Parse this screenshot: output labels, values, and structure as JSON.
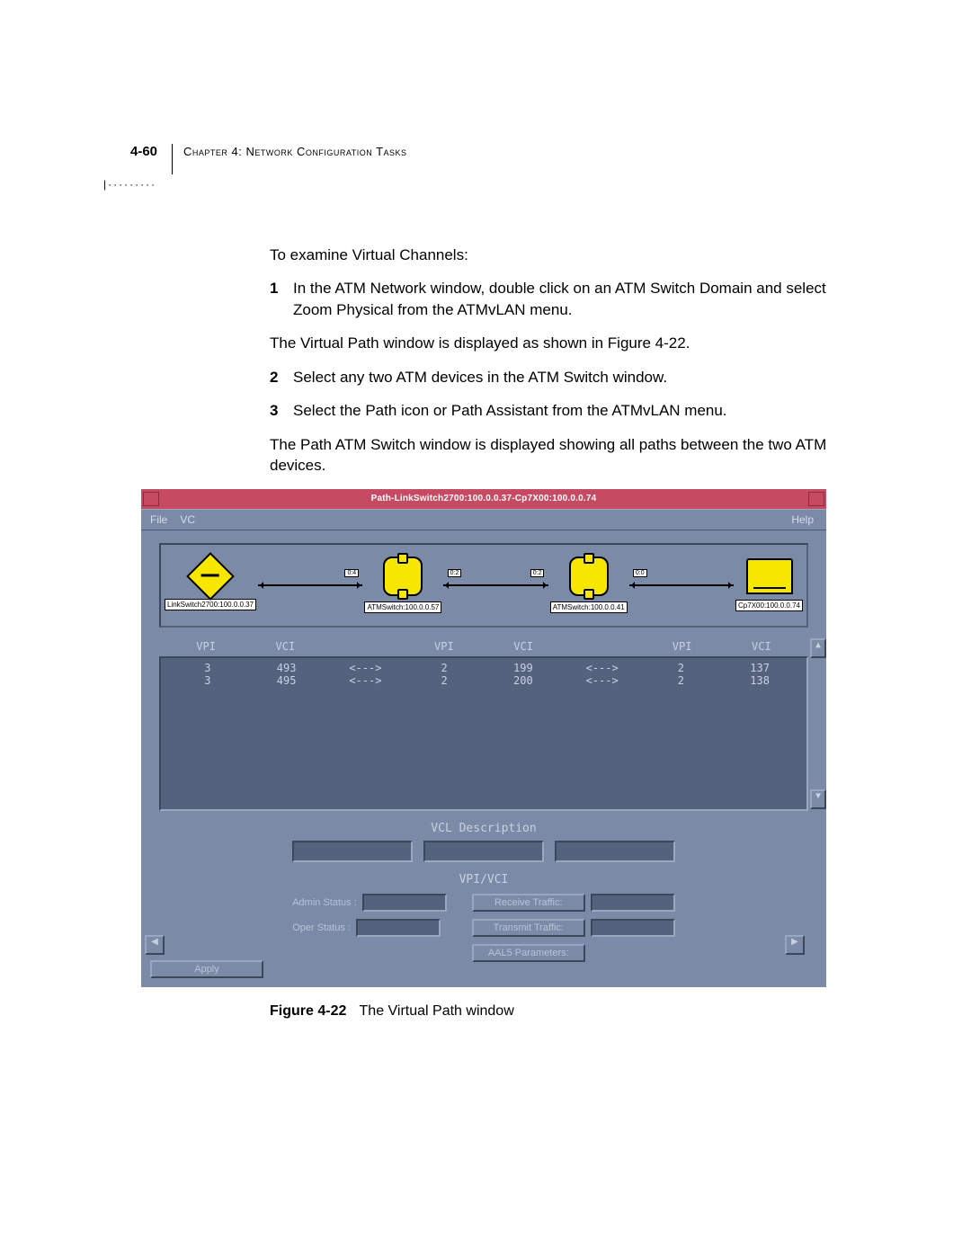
{
  "header": {
    "page_number": "4-60",
    "chapter": "Chapter 4: Network Configuration Tasks"
  },
  "intro": "To examine Virtual Channels:",
  "steps": [
    {
      "n": "1",
      "text": "In the ATM Network window, double click on an ATM Switch Domain and select Zoom Physical from the ATMvLAN menu."
    },
    {
      "after": "The Virtual Path window is displayed as shown in Figure 4-22."
    },
    {
      "n": "2",
      "text": "Select any two ATM devices in the ATM Switch window."
    },
    {
      "n": "3",
      "text": "Select the Path icon or Path Assistant from the ATMvLAN menu."
    },
    {
      "after": "The Path ATM Switch window is displayed showing all paths between the two ATM devices."
    }
  ],
  "window": {
    "title": "Path-LinkSwitch2700:100.0.0.37-Cp7X00:100.0.0.74",
    "menu": {
      "file": "File",
      "vc": "VC",
      "help": "Help"
    },
    "nodes": [
      {
        "label": "LinkSwitch2700:100.0.0.37"
      },
      {
        "label": "ATMSwitch:100.0.0.57",
        "port_left": "0:4",
        "port_right": "0:2"
      },
      {
        "label": "ATMSwitch:100.0.0.41",
        "port_left": "0:2",
        "port_right": "0:0"
      },
      {
        "label": "Cp7X00:100.0.0.74"
      }
    ],
    "columns": [
      "VPI",
      "VCI",
      "",
      "VPI",
      "VCI",
      "",
      "VPI",
      "VCI"
    ],
    "rows": [
      [
        "3",
        "493",
        "<--->",
        "2",
        "199",
        "<--->",
        "2",
        "137"
      ],
      [
        "3",
        "495",
        "<--->",
        "2",
        "200",
        "<--->",
        "2",
        "138"
      ]
    ],
    "vcl_label": "VCL Description",
    "vpivci_label": "VPI/VCI",
    "admin_status": "Admin Status :",
    "oper_status": "Oper Status :",
    "receive_btn": "Receive Traffic:",
    "transmit_btn": "Transmit Traffic:",
    "aal5_btn": "AAL5 Parameters:",
    "apply": "Apply"
  },
  "caption": {
    "fig": "Figure 4-22",
    "text": "The Virtual Path window"
  }
}
